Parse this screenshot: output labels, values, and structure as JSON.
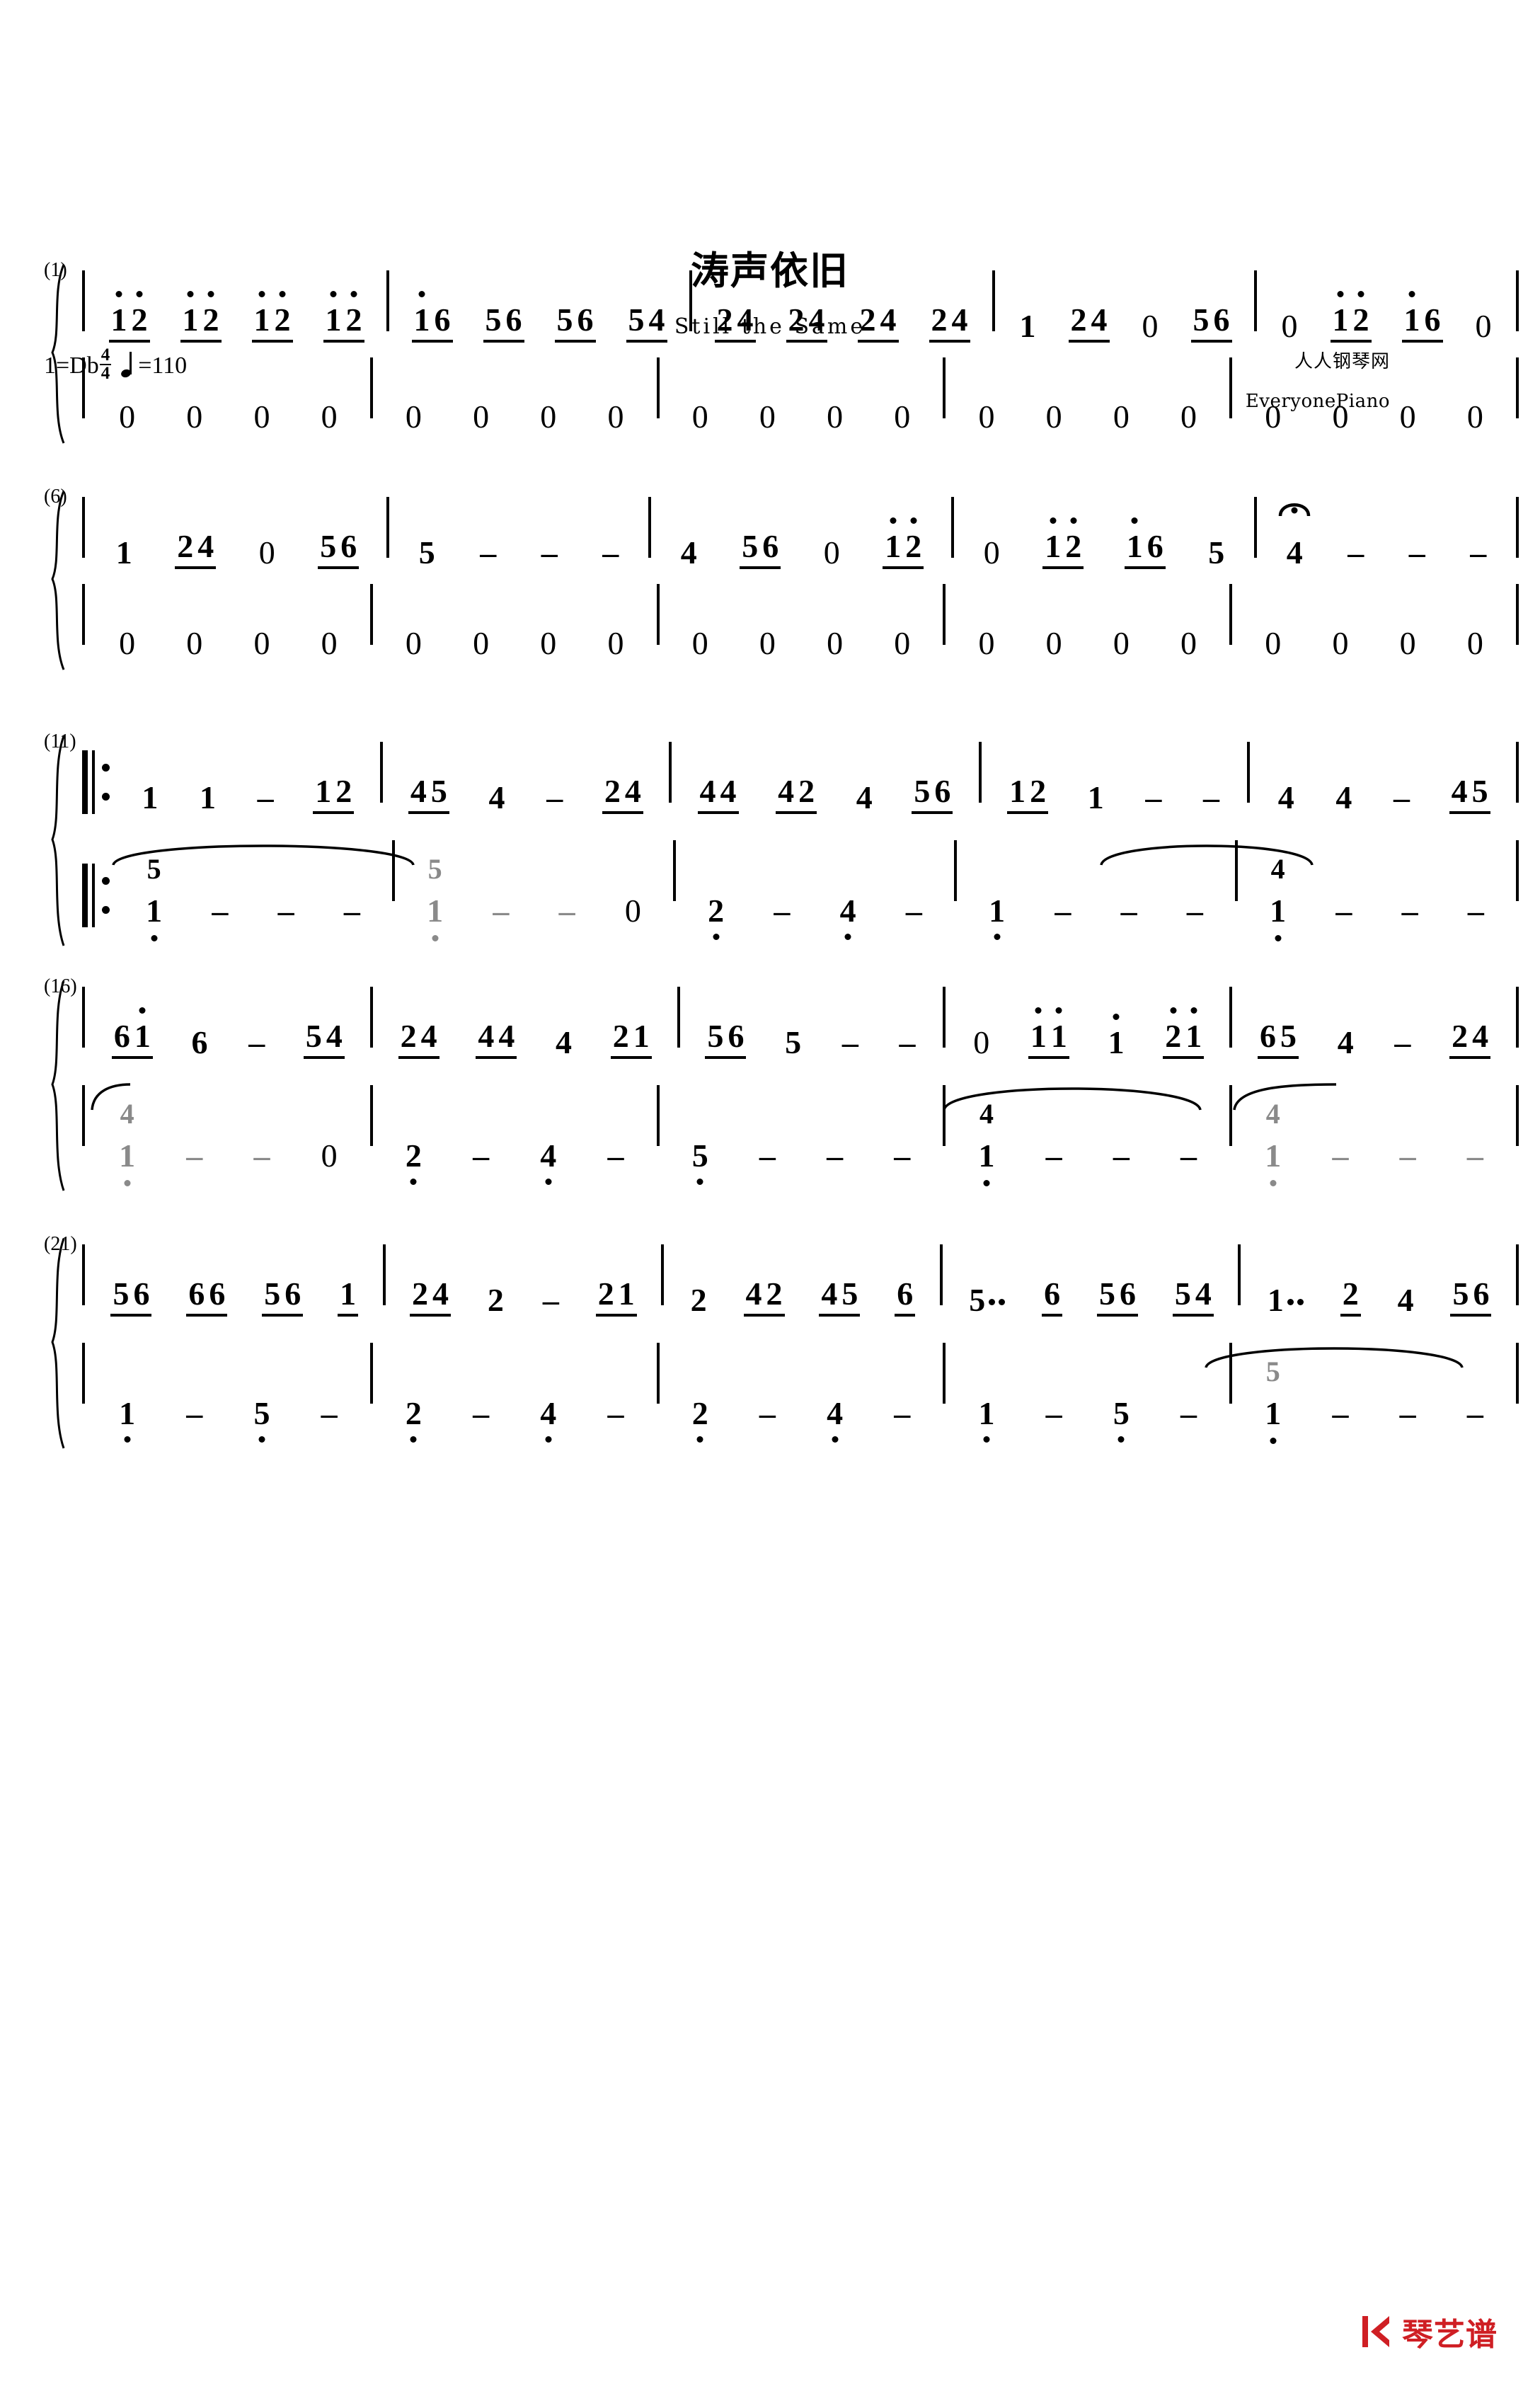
{
  "score": {
    "title": "涛声依旧",
    "subtitle": "Still the Same",
    "key_signature": "1=Db",
    "time_signature": {
      "numerator": "4",
      "denominator": "4"
    },
    "tempo_note_icon": "quarter-note-icon",
    "tempo_text": "=110",
    "credits": {
      "site_cn": "人人钢琴网",
      "site_en": "EveryonePiano"
    },
    "footer": {
      "logo_icon": "qinyipu-logo-icon",
      "logo_text": "琴艺谱",
      "logo_color": "#cf1f24"
    }
  },
  "systems": [
    {
      "label": "(1)",
      "measure_start": 1,
      "treble": [
        {
          "notes": [
            {
              "groups": [
                [
                  "1^",
                  "2^"
                ],
                [
                  "1^",
                  "2^"
                ],
                [
                  "1^",
                  "2^"
                ],
                [
                  "1^",
                  "2^"
                ]
              ]
            }
          ]
        },
        {
          "notes": [
            {
              "groups": [
                [
                  "1^",
                  "6"
                ],
                [
                  "5",
                  "6"
                ],
                [
                  "5",
                  "6"
                ],
                [
                  "5",
                  "4"
                ]
              ]
            }
          ]
        },
        {
          "notes": [
            {
              "groups": [
                [
                  "2",
                  "4"
                ],
                [
                  "2",
                  "4"
                ],
                [
                  "2",
                  "4"
                ],
                [
                  "2",
                  "4"
                ]
              ]
            }
          ]
        },
        {
          "notes": [
            {
              "plain": [
                "1"
              ],
              "groups": [
                [
                  "2",
                  "4"
                ]
              ],
              "after": [
                "0"
              ],
              "groups2": [
                [
                  "5",
                  "6"
                ]
              ]
            }
          ]
        },
        {
          "notes": [
            {
              "plain": [
                "0"
              ],
              "groups": [
                [
                  "1^",
                  "2^"
                ],
                [
                  "1^",
                  "6"
                ]
              ],
              "after": [
                "0"
              ]
            }
          ]
        }
      ],
      "bass": [
        [
          "0",
          "0",
          "0",
          "0"
        ],
        [
          "0",
          "0",
          "0",
          "0"
        ],
        [
          "0",
          "0",
          "0",
          "0"
        ],
        [
          "0",
          "0",
          "0",
          "0"
        ],
        [
          "0",
          "0",
          "0",
          "0"
        ]
      ]
    },
    {
      "label": "(6)",
      "measure_start": 6,
      "bass": [
        [
          "0",
          "0",
          "0",
          "0"
        ],
        [
          "0",
          "0",
          "0",
          "0"
        ],
        [
          "0",
          "0",
          "0",
          "0"
        ],
        [
          "0",
          "0",
          "0",
          "0"
        ],
        [
          "0",
          "0",
          "0",
          "0"
        ]
      ]
    },
    {
      "label": "(11)",
      "measure_start": 11
    },
    {
      "label": "(16)",
      "measure_start": 16
    },
    {
      "label": "(21)",
      "measure_start": 21
    }
  ],
  "m": {
    "s1": {
      "t1": [
        "1",
        "2",
        "1",
        "2",
        "1",
        "2",
        "1",
        "2"
      ],
      "t2": [
        "1",
        "6",
        "5",
        "6",
        "5",
        "6",
        "5",
        "4"
      ],
      "t3": [
        "2",
        "4",
        "2",
        "4",
        "2",
        "4",
        "2",
        "4"
      ],
      "t4": [
        "1",
        "2",
        "4",
        "0",
        "5",
        "6"
      ],
      "t5": [
        "0",
        "1",
        "2",
        "1",
        "6",
        "0"
      ],
      "b": [
        "0",
        "0",
        "0",
        "0",
        "0",
        "0",
        "0",
        "0",
        "0",
        "0",
        "0",
        "0",
        "0",
        "0",
        "0",
        "0",
        "0",
        "0",
        "0",
        "0"
      ]
    },
    "s2": {
      "t1": [
        "1",
        "2",
        "4",
        "0",
        "5",
        "6"
      ],
      "t2": [
        "5",
        "–",
        "–",
        "–"
      ],
      "t3": [
        "4",
        "5",
        "6",
        "0",
        "1",
        "2"
      ],
      "t4": [
        "0",
        "1",
        "2",
        "1",
        "6",
        "5"
      ],
      "t5": [
        "4",
        "–",
        "–",
        "–"
      ],
      "b": [
        "0",
        "0",
        "0",
        "0",
        "0",
        "0",
        "0",
        "0",
        "0",
        "0",
        "0",
        "0",
        "0",
        "0",
        "0",
        "0",
        "0",
        "0",
        "0",
        "0"
      ]
    },
    "s3": {
      "t1": [
        "1",
        "1",
        "–",
        "1",
        "2"
      ],
      "t2": [
        "4",
        "5",
        "4",
        "–",
        "2",
        "4"
      ],
      "t3": [
        "4",
        "4",
        "4",
        "2",
        "4",
        "5",
        "6"
      ],
      "t4": [
        "1",
        "2",
        "1",
        "–",
        "–"
      ],
      "t5": [
        "4",
        "4",
        "–",
        "4",
        "5"
      ],
      "b1": {
        "upper": "5",
        "main": "1",
        "tail": [
          "–",
          "–",
          "–"
        ]
      },
      "b2": {
        "upper": "5",
        "main": "1",
        "tail": [
          "–",
          "–",
          "0"
        ]
      },
      "b3": [
        "2",
        "–",
        "4",
        "–"
      ],
      "b4": [
        "1",
        "–",
        "–",
        "–"
      ],
      "b5": {
        "upper": "4",
        "main": "1",
        "tail": [
          "–",
          "–",
          "–"
        ]
      }
    },
    "s4": {
      "t1": [
        "6",
        "1",
        "6",
        "–",
        "5",
        "4"
      ],
      "t2": [
        "2",
        "4",
        "4",
        "4",
        "4",
        "2",
        "1"
      ],
      "t3": [
        "5",
        "6",
        "5",
        "–",
        "–"
      ],
      "t4": [
        "0",
        "1",
        "1",
        "1",
        "2",
        "1"
      ],
      "t5": [
        "6",
        "5",
        "4",
        "–",
        "2",
        "4"
      ],
      "b1": {
        "upper": "4",
        "main": "1",
        "tail": [
          "–",
          "–",
          "0"
        ]
      },
      "b2": [
        "2",
        "–",
        "4",
        "–"
      ],
      "b3": [
        "5",
        "–",
        "–",
        "–"
      ],
      "b4": {
        "upper": "4",
        "main": "1",
        "tail": [
          "–",
          "–",
          "–"
        ]
      },
      "b5": {
        "upper": "4",
        "main": "1",
        "tail": [
          "–",
          "–",
          "–"
        ]
      }
    },
    "s5": {
      "t1": [
        "5",
        "6",
        "6",
        "6",
        "5",
        "6",
        "1"
      ],
      "t2": [
        "2",
        "4",
        "2",
        "–",
        "2",
        "1"
      ],
      "t3": [
        "2",
        "4",
        "2",
        "4",
        "5",
        "6"
      ],
      "t4": [
        "5",
        "6",
        "5",
        "6",
        "5",
        "4"
      ],
      "t5": [
        "1",
        "2",
        "4",
        "5",
        "6"
      ],
      "b1": [
        "1",
        "–",
        "5",
        "–"
      ],
      "b2": [
        "2",
        "–",
        "4",
        "–"
      ],
      "b3": [
        "2",
        "–",
        "4",
        "–"
      ],
      "b4": [
        "1",
        "–",
        "5",
        "–"
      ],
      "b5": {
        "upper": "5",
        "main": "1",
        "tail": [
          "–",
          "–",
          "–"
        ]
      }
    }
  },
  "symbols": {
    "fermata": "fermata-icon",
    "repeat_start": "repeat-start-icon",
    "brace": "system-brace-icon",
    "barline": "barline-icon",
    "dash": "–",
    "rest": "0"
  }
}
